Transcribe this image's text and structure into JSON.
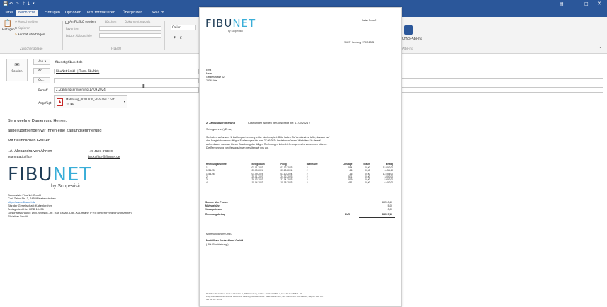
{
  "titlebar": {
    "icons": [
      "save-icon",
      "undo-icon",
      "redo-icon",
      "up-arrow-icon",
      "down-arrow-icon",
      "customize-icon"
    ],
    "window_controls": [
      "ribbon-display-icon",
      "minimize-icon",
      "restore-icon",
      "close-icon"
    ]
  },
  "tabs": [
    "Datei",
    "Nachricht",
    "Einfügen",
    "Optionen",
    "Text formatieren",
    "Überprüfen",
    "Was m"
  ],
  "active_tab": "Nachricht",
  "ribbon": {
    "paste_label": "Einfügen",
    "cut": "Ausschneiden",
    "copy": "Kopieren",
    "format_painter": "Format übertragen",
    "clipboard_group": "Zwischenablage",
    "fileo_send_label": "An FILERO senden",
    "delete": "Löschen",
    "document_pool": "Dokumentenpools",
    "favorites": "Favoriten",
    "last_storage": "Letzte Ablageziele",
    "filero_group": "FILERO",
    "font_name": "Calibri",
    "office_addins": "Office-Add-Ins",
    "addins_group": "Add-Ins"
  },
  "compose": {
    "send_label": "Senden",
    "from_label": "Von",
    "from_value": "fibunet@fibunet.de",
    "to_label": "An...",
    "to_value": "FibuNet GmbH | Team FibuNet;",
    "cc_label": "Cc...",
    "subject_label": "Betreff",
    "subject_value": "2. Zahlungserinnerung 17.09.2024",
    "attached_label": "Angefügt",
    "attachment_name": "Mahnung_0001000_20240917.pdf",
    "attachment_size": "20 KB"
  },
  "body": {
    "greeting": "Sehr geehrte Damen und Herren,",
    "line1": "anbei übersenden wir Ihnen eine Zahlungserinnerung",
    "line2": "Mit freundlichen Grüßen",
    "sig_name": "i.A. Alexandra von Ahnen",
    "sig_team": "Team Backoffice",
    "sig_phone": "+49 4191 8739-0",
    "sig_email": "backoffice@fibunet.de",
    "logo_text": "FIBUNET",
    "logo_sub": "by Scopevisio",
    "footer_company": "Scopevisio FibuNet GmbH",
    "footer_address": "Carl-Zeiss-Str. 3, 24568 Kaltenkirchen",
    "footer_web": "https://www.fibunet.de",
    "footer_seat": "Sitz der Gesellschaft: Kaltenkirchen",
    "footer_court": "Amtsgericht Kiel HRB 10436",
    "footer_mgmt": "Geschäftsführung: Dipl.-Wirtsch.-Inf. Ralf Graap, Dipl.-Kaufmann (FH) Torsten Friedrich von Ahnen,",
    "footer_mgmt2": "Christian Serviti"
  },
  "document": {
    "logo_text": "FIBUNET",
    "logo_sub": "by Scopevisio",
    "page": "Seite:    1 von 1",
    "place_date": "20457 Hamburg,   17.09.2024",
    "addr1": "Erna",
    "addr2": "Meier",
    "addr3": "Gerstestrasse 62",
    "addr4": "24048 Kiel",
    "title": "2. Zahlungserinnerung",
    "title_note": "( Zahlungen wurden berücksichtigt bis:  17.09.2024 )",
    "salutation": "Sehr geehrte(r)  Erna,",
    "para1": "Sie haben auf unsere 1. Zahlungserinnerung leider nicht reagiert. Bitte haben Sie Verständnis dafür, dass wir auf",
    "para2": "den Ausgleich unserer fälligen Forderungen  bis zum 27.09.2024 bestehen müssen. Wir bitten Sie darauf",
    "para3": "aufmerksam, dass wir bis zur Bezahlung der fälligen Rechnungen keine Lieferungen mehr vornehmen können.",
    "para4": "Die Berechnung von Verzugszinsen behalten wir uns vor.",
    "table_headers": [
      "Rechnungsnummer",
      "Belegdatum",
      "Fällig",
      "Mahnstufe",
      "Zinstage",
      "Zinsen",
      "Betrag"
    ],
    "table_rows": [
      [
        "1",
        "02.01.2023",
        "01.02.2023",
        "2",
        "594",
        "0,00",
        "15.000,00"
      ],
      [
        "1234-25",
        "03.09.2024",
        "03.10.2024",
        "2",
        "-16",
        "0,00",
        "6.454,40"
      ],
      [
        "1234-26",
        "03.09.2024",
        "03.10.2024",
        "2",
        "-16",
        "0,00",
        "12.456,00"
      ],
      [
        "2",
        "25.01.2023",
        "24.02.2023",
        "2",
        "571",
        "0,00",
        "3.000,00"
      ],
      [
        "3",
        "28.03.2023",
        "27.04.2023",
        "2",
        "509",
        "0,00",
        "5.600,00"
      ],
      [
        "4",
        "15.04.2023",
        "15.05.2023",
        "2",
        "491",
        "0,00",
        "6.400,00"
      ]
    ],
    "sum_label": "Summe aller Posten",
    "sum_value": "58.910,40",
    "fee_label": "Mahngebühr",
    "fee_value": "5,00",
    "interest_label": "Verzugszinsen",
    "interest_value": "0,00",
    "total_label": "Rechnungsbetrag",
    "total_currency": "EUR",
    "total_value": "58.917,40",
    "closing": "Mit freundlichem Gruß",
    "company": "Modellbau Deutschland GmbH",
    "dept": "( Abt. Buchhaltung )",
    "footer1": "Modellbau Deutschland GmbH ; Admiralstr. 3, 20457  Hamburg, Telefon +49 40 / 956542 - 0,  Fax +49 40 / 956542 - 20,",
    "footer2": "info@modellbaudeutschland.de,  HRB 12030 Hamburg,  Geschäftsführer: Heike Mustermann, Jahr. Aufsichtsrat: Dirk Matthes, Stephan Dier,  Ust.",
    "footer3": "Idnr DE 107 110 04"
  },
  "colors": {
    "titlebar": "#2b579a",
    "logo_dark": "#1f3d57",
    "logo_accent": "#3aaed8",
    "link": "#0563c1"
  }
}
